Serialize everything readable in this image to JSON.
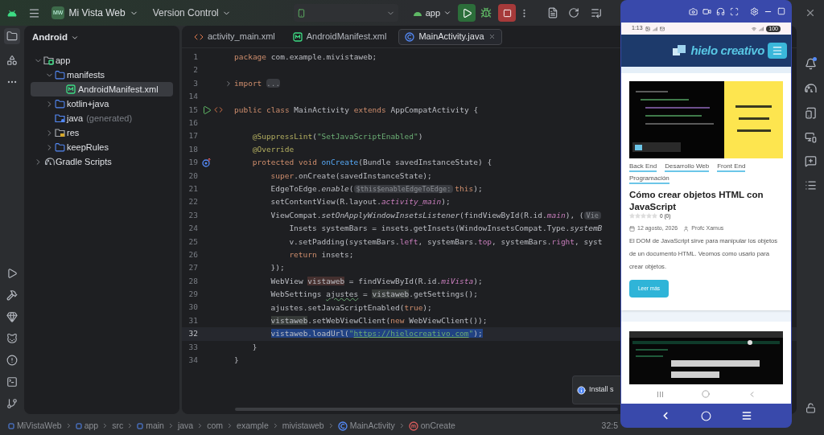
{
  "top_bar": {
    "project_badge": "MW",
    "project": "Mi Vista Web",
    "vcs": "Version Control",
    "run_config": "app"
  },
  "project_panel": {
    "title": "Android",
    "tree": [
      {
        "label": "app",
        "kind": "module",
        "expanded": true,
        "selected": false,
        "children": [
          {
            "label": "manifests",
            "kind": "folder",
            "expanded": true,
            "selected": false,
            "children": [
              {
                "label": "AndroidManifest.xml",
                "kind": "manifest",
                "selected": true
              }
            ]
          },
          {
            "label": "kotlin+java",
            "kind": "folder",
            "expanded": false,
            "selected": false
          },
          {
            "label": "java",
            "suffix": "(generated)",
            "kind": "generated",
            "selected": false
          },
          {
            "label": "res",
            "kind": "res",
            "expanded": false,
            "selected": false
          },
          {
            "label": "keepRules",
            "kind": "folder",
            "expanded": false,
            "selected": false
          }
        ]
      },
      {
        "label": "Gradle Scripts",
        "kind": "gradle",
        "expanded": false,
        "selected": false
      }
    ]
  },
  "editor_tabs": [
    {
      "label": "activity_main.xml",
      "kind": "xml",
      "selected": false
    },
    {
      "label": "AndroidManifest.xml",
      "kind": "manifest",
      "selected": false
    },
    {
      "label": "MainActivity.java",
      "kind": "class",
      "selected": true
    }
  ],
  "code_lines": [
    {
      "number": "1",
      "selected": false,
      "tokens": [
        {
          "t": "package",
          "kind": "kw"
        },
        {
          "t": " com.example.mivistaweb;",
          "kind": "plain"
        }
      ]
    },
    {
      "number": "2",
      "selected": false
    },
    {
      "number": "3",
      "selected": false,
      "kind": "fold",
      "tokens": [
        {
          "t": "import",
          "kind": "kw"
        },
        {
          "t": "...",
          "kind": "fold"
        }
      ]
    },
    {
      "number": "14",
      "selected": false
    },
    {
      "number": "15",
      "selected": false,
      "kind": "run",
      "tokens": [
        {
          "t": "public class",
          "kind": "kw"
        },
        {
          "t": " MainActivity ",
          "kind": "plain"
        },
        {
          "t": "extends",
          "kind": "kw"
        },
        {
          "t": " AppCompatActivity {",
          "kind": "plain"
        }
      ]
    },
    {
      "number": "16",
      "selected": false
    },
    {
      "number": "17",
      "selected": false,
      "tokens": [
        {
          "t": "@SuppressLint",
          "kind": "ann"
        },
        {
          "t": "(",
          "kind": "plain"
        },
        {
          "t": "\"SetJavaScriptEnabled\"",
          "kind": "str"
        },
        {
          "t": ")",
          "kind": "plain"
        }
      ]
    },
    {
      "number": "18",
      "selected": false,
      "tokens": [
        {
          "t": "@Override",
          "kind": "ann"
        }
      ]
    },
    {
      "number": "19",
      "selected": false,
      "kind": "override",
      "tokens": [
        {
          "t": "protected void",
          "kind": "kw"
        },
        {
          "t": "onCreate",
          "kind": "fn"
        },
        {
          "t": "(Bundle savedInstanceState) {",
          "kind": "plain"
        }
      ]
    },
    {
      "number": "20",
      "selected": false,
      "tokens": [
        {
          "t": "super",
          "kind": "kw"
        },
        {
          "t": ".onCreate(savedInstanceState);",
          "kind": "plain"
        }
      ]
    },
    {
      "number": "21",
      "selected": false,
      "tokens": [
        {
          "t": "EdgeToEdge.",
          "kind": "plain"
        },
        {
          "t": "enable",
          "kind": "italic"
        },
        {
          "t": "(",
          "kind": "plain"
        },
        {
          "t": "$this$enableEdgeToEdge:",
          "kind": "hint"
        },
        {
          "t": "this",
          "kind": "kw"
        },
        {
          "t": ");",
          "kind": "plain"
        }
      ]
    },
    {
      "number": "22",
      "selected": false,
      "tokens": [
        {
          "t": "setContentView(R.layout.",
          "kind": "plain"
        },
        {
          "t": "activity_main",
          "kind": "field"
        },
        {
          "t": ");",
          "kind": "plain"
        }
      ]
    },
    {
      "number": "23",
      "selected": false,
      "tokens": [
        {
          "t": "ViewCompat.",
          "kind": "plain"
        },
        {
          "t": "setOnApplyWindowInsetsListener",
          "kind": "italic"
        },
        {
          "t": "(findViewById(R.id.",
          "kind": "plain"
        },
        {
          "t": "main",
          "kind": "field"
        },
        {
          "t": "), (",
          "kind": "plain"
        },
        {
          "t": "Vie",
          "kind": "hint"
        }
      ]
    },
    {
      "number": "24",
      "selected": false,
      "tokens": [
        {
          "t": "Insets systemBars = insets.getInsets(WindowInsetsCompat.Type.",
          "kind": "plain"
        },
        {
          "t": "systemB",
          "kind": "italic"
        }
      ]
    },
    {
      "number": "25",
      "selected": false,
      "tokens": [
        {
          "t": "v.setPadding(systemBars.",
          "kind": "plain"
        },
        {
          "t": "left",
          "kind": "member"
        },
        {
          "t": ", systemBars.",
          "kind": "plain"
        },
        {
          "t": "top",
          "kind": "member"
        },
        {
          "t": ", systemBars.",
          "kind": "plain"
        },
        {
          "t": "right",
          "kind": "member"
        },
        {
          "t": ", syst",
          "kind": "plain"
        }
      ]
    },
    {
      "number": "26",
      "selected": false,
      "tokens": [
        {
          "t": "return",
          "kind": "kw"
        },
        {
          "t": " insets;",
          "kind": "plain"
        }
      ]
    },
    {
      "number": "27",
      "selected": false,
      "tokens": [
        {
          "t": "});",
          "kind": "plain"
        }
      ]
    },
    {
      "number": "28",
      "selected": false,
      "tokens": [
        {
          "t": "WebView ",
          "kind": "plain"
        },
        {
          "t": "vistaweb",
          "kind": "decl"
        },
        {
          "t": " = findViewById(R.id.",
          "kind": "plain"
        },
        {
          "t": "miVista",
          "kind": "field"
        },
        {
          "t": ");",
          "kind": "plain"
        }
      ]
    },
    {
      "number": "29",
      "selected": false,
      "tokens": [
        {
          "t": "WebSettings ",
          "kind": "plain"
        },
        {
          "t": "ajustes",
          "kind": "warn"
        },
        {
          "t": " = ",
          "kind": "plain"
        },
        {
          "t": "vistaweb",
          "kind": "usage"
        },
        {
          "t": ".getSettings();",
          "kind": "plain"
        }
      ]
    },
    {
      "number": "30",
      "selected": false,
      "tokens": [
        {
          "t": "ajustes.setJavaScriptEnabled(",
          "kind": "plain"
        },
        {
          "t": "true",
          "kind": "kw"
        },
        {
          "t": ");",
          "kind": "plain"
        }
      ]
    },
    {
      "number": "31",
      "selected": false,
      "tokens": [
        {
          "t": "vistaweb",
          "kind": "usage"
        },
        {
          "t": ".setWebViewClient(",
          "kind": "plain"
        },
        {
          "t": "new",
          "kind": "kw"
        },
        {
          "t": " WebViewClient());",
          "kind": "plain"
        }
      ]
    },
    {
      "number": "32",
      "selected": true,
      "tokens": [
        {
          "t": "vistaweb.loadUrl(",
          "kind": "plain"
        },
        {
          "t": "\"",
          "kind": "str"
        },
        {
          "t": "https://hielocreativo.com",
          "kind": "url"
        },
        {
          "t": "\"",
          "kind": "str"
        },
        {
          "t": ");",
          "kind": "plain"
        }
      ]
    },
    {
      "number": "33",
      "selected": false,
      "tokens": [
        {
          "t": "}",
          "kind": "plain"
        }
      ]
    },
    {
      "number": "34",
      "selected": false,
      "tokens": [
        {
          "t": "}",
          "kind": "plain"
        }
      ]
    }
  ],
  "notification": {
    "text": "Install s"
  },
  "status_bar": {
    "breadcrumbs": [
      {
        "label": "MiVistaWeb",
        "kind": "module"
      },
      {
        "label": "app",
        "kind": "module"
      },
      {
        "label": "src",
        "kind": "dir"
      },
      {
        "label": "main",
        "kind": "module"
      },
      {
        "label": "java",
        "kind": "dir"
      },
      {
        "label": "com",
        "kind": "dir"
      },
      {
        "label": "example",
        "kind": "dir"
      },
      {
        "label": "mivistaweb",
        "kind": "dir"
      },
      {
        "label": "MainActivity",
        "kind": "class"
      },
      {
        "label": "onCreate",
        "kind": "method"
      }
    ],
    "cursor": "32:5"
  },
  "emulator": {
    "status_time": "1:13",
    "battery": "100",
    "logo": "hielo creativo",
    "articles": [
      {
        "kind": "full",
        "categories": [
          "Back End",
          "Desarrollo Web",
          "Front End",
          "Programación"
        ],
        "title": "Cómo crear objetos HTML con JavaScript",
        "stars": 0,
        "rating": "0 (0)",
        "date": "12 agosto, 2026",
        "author": "Profc Xamus",
        "excerpt": "El DOM de JavaScript sirve para manipular los objetos de un documento HTML. Veomos como usarlo para crear objetos.",
        "button": "Leer más"
      },
      {
        "kind": "image_only"
      }
    ]
  }
}
